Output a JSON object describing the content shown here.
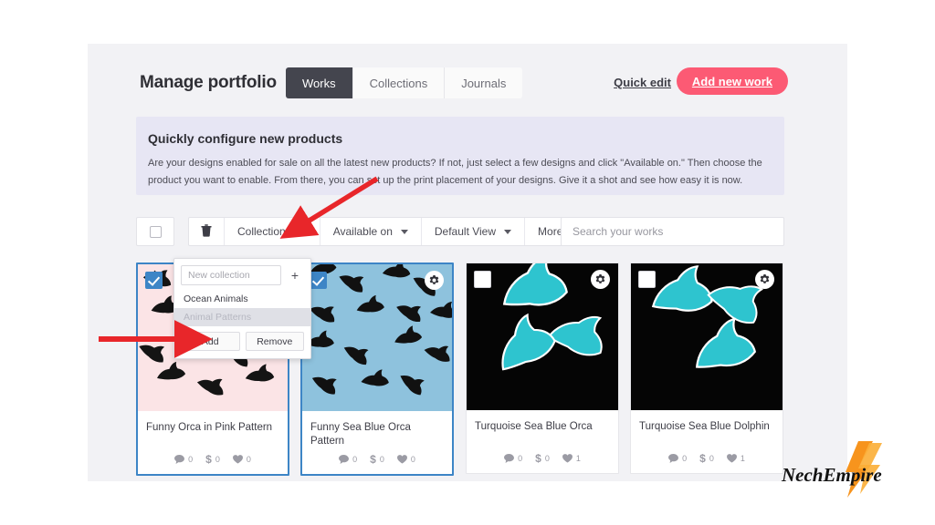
{
  "header": {
    "title": "Manage portfolio",
    "tabs": [
      {
        "label": "Works",
        "active": true
      },
      {
        "label": "Collections",
        "active": false
      },
      {
        "label": "Journals",
        "active": false
      }
    ],
    "quick_edit_label": "Quick edit",
    "add_new_work_label": "Add new work",
    "accent_color": "#fc5a74",
    "active_tab_color": "#44454e"
  },
  "banner": {
    "title": "Quickly configure new products",
    "text": "Are your designs enabled for sale on all the latest new products? If not, just select a few designs and click \"Available on.\" Then choose the product you want to enable. From there, you can set up the print placement of your designs. Give it a shot and see how easy it is now.",
    "background_color": "#e7e6f4"
  },
  "toolbar": {
    "select_all_checked": false,
    "delete_icon": "trash-icon",
    "filters": [
      {
        "label": "Collections",
        "icon": "chevron-down-icon"
      },
      {
        "label": "Available on",
        "icon": "chevron-down-icon"
      },
      {
        "label": "Default View",
        "icon": "chevron-down-icon"
      },
      {
        "label": "More",
        "icon": "chevron-down-icon"
      }
    ],
    "search": {
      "value": "",
      "placeholder": "Search your works"
    }
  },
  "collections_dropdown": {
    "open": true,
    "new_collection": {
      "value": "",
      "placeholder": "New collection"
    },
    "add_icon": "plus-icon",
    "items": [
      {
        "label": "Ocean Animals",
        "highlighted": false
      },
      {
        "label": "Animal Patterns",
        "highlighted": true
      }
    ],
    "add_label": "Add",
    "remove_label": "Remove"
  },
  "works": [
    {
      "title": "Funny Orca in Pink Pattern",
      "selected": true,
      "checked": true,
      "gear_icon": "gear-icon",
      "thumb_bg": "#fbe4e6",
      "thumb_style": "pattern",
      "stats": {
        "comments": "0",
        "sales": "0",
        "favorites": "0"
      }
    },
    {
      "title": "Funny Sea Blue Orca Pattern",
      "selected": true,
      "checked": true,
      "gear_icon": "gear-icon",
      "thumb_bg": "#8ec2dd",
      "thumb_style": "pattern",
      "stats": {
        "comments": "0",
        "sales": "0",
        "favorites": "0"
      }
    },
    {
      "title": "Turquoise Sea Blue Orca",
      "selected": false,
      "checked": false,
      "gear_icon": "gear-icon",
      "thumb_bg": "#050505",
      "thumb_style": "single",
      "stats": {
        "comments": "0",
        "sales": "0",
        "favorites": "1"
      }
    },
    {
      "title": "Turquoise Sea Blue Dolphin",
      "selected": false,
      "checked": false,
      "gear_icon": "gear-icon",
      "thumb_bg": "#050505",
      "thumb_style": "single",
      "stats": {
        "comments": "0",
        "sales": "0",
        "favorites": "1"
      }
    }
  ],
  "stat_icons": {
    "comments": "comment-bubble-icon",
    "sales": "dollar-icon",
    "favorites": "heart-icon"
  },
  "annotations": {
    "arrow_color": "#e8262a",
    "arrows": [
      {
        "name": "arrow-to-collections-filter",
        "direction": "down-left"
      },
      {
        "name": "arrow-to-add-button",
        "direction": "right"
      }
    ]
  },
  "watermark": {
    "text": "NechEmpire",
    "bolt_color": "#f7941d"
  }
}
